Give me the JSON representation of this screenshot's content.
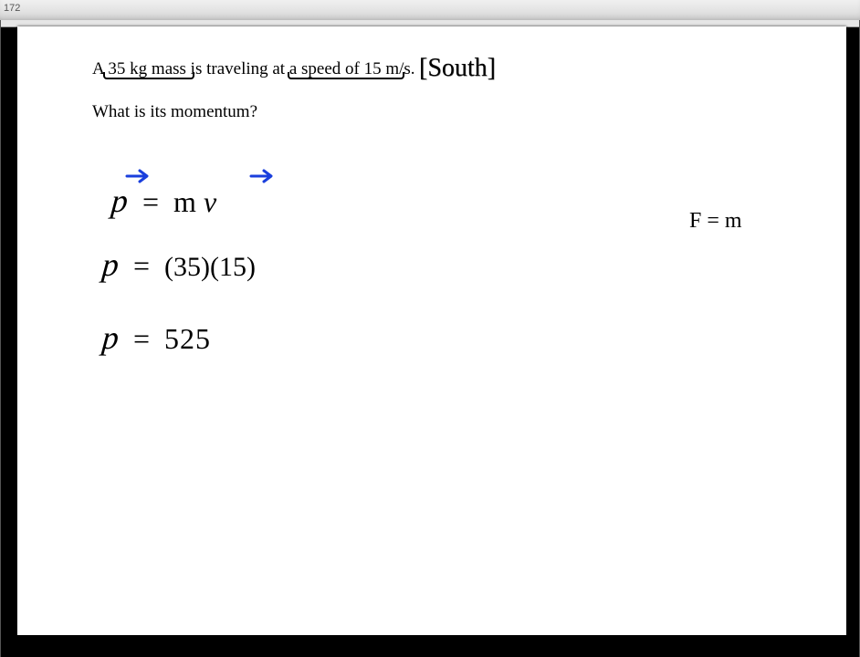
{
  "window": {
    "page_number": "172"
  },
  "problem": {
    "line1": "A 35 kg mass is traveling at a speed of 15 m/s.",
    "line2": "What is its momentum?",
    "direction_annotation": "[South]"
  },
  "work": {
    "equation1": "p⃗ = m v⃗",
    "equation2": "p = (35)(15)",
    "equation3": "p = 525",
    "side_note": "F = m"
  }
}
